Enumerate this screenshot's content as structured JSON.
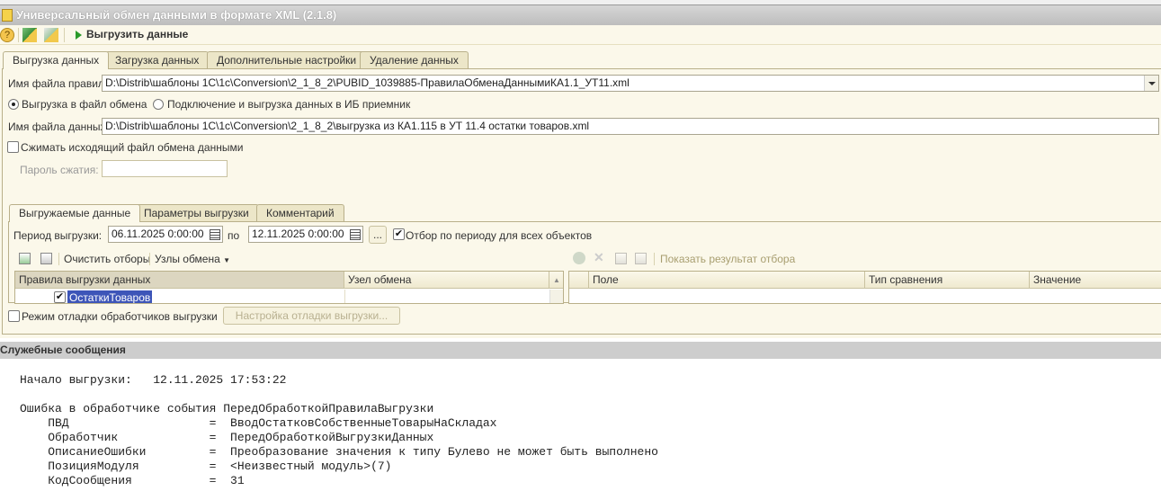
{
  "window": {
    "title": "Универсальный обмен данными в формате XML (2.1.8)"
  },
  "toolbar": {
    "run_label": "Выгрузить данные"
  },
  "tabs": [
    {
      "label": "Выгрузка данных"
    },
    {
      "label": "Загрузка данных"
    },
    {
      "label": "Дополнительные настройки"
    },
    {
      "label": "Удаление данных"
    }
  ],
  "form": {
    "rules_file_label": "Имя файла правил:",
    "rules_file_value": "D:\\Distrib\\шаблоны 1С\\1с\\Conversion\\2_1_8_2\\PUBID_1039885-ПравилаОбменаДаннымиКА1.1_УТ11.xml",
    "radio_file": "Выгрузка в файл обмена",
    "radio_ib": "Подключение и выгрузка данных в ИБ приемник",
    "data_file_label": "Имя файла данных:",
    "data_file_value": "D:\\Distrib\\шаблоны 1С\\1с\\Conversion\\2_1_8_2\\выгрузка из КА1.115 в УТ 11.4 остатки товаров.xml",
    "compress_label": "Сжимать исходящий файл обмена данными",
    "password_label": "Пароль сжатия:",
    "password_value": ""
  },
  "inner_tabs": [
    {
      "label": "Выгружаемые данные"
    },
    {
      "label": "Параметры выгрузки"
    },
    {
      "label": "Комментарий"
    }
  ],
  "period": {
    "label": "Период выгрузки:",
    "from": "06.11.2025  0:00:00",
    "to_label": "по",
    "to": "12.11.2025  0:00:00",
    "more": "...",
    "filter_all": "Отбор по периоду для всех объектов"
  },
  "rules_toolbar": {
    "clear": "Очистить отборы",
    "nodes": "Узлы обмена"
  },
  "filter_toolbar": {
    "show_result": "Показать результат отбора"
  },
  "rules_table": {
    "columns": [
      "Правила выгрузки данных",
      "Узел обмена"
    ],
    "rows": [
      {
        "name": "ОстаткиТоваров",
        "checked": true,
        "node": ""
      }
    ]
  },
  "filter_table": {
    "columns": [
      "Поле",
      "Тип сравнения",
      "Значение"
    ]
  },
  "debug": {
    "label": "Режим отладки обработчиков выгрузки",
    "button": "Настройка отладки выгрузки..."
  },
  "messages": {
    "title": "Служебные сообщения",
    "lines": [
      "Начало выгрузки:   12.11.2025 17:53:22",
      "Ошибка в обработчике события ПередОбработкойПравилаВыгрузки",
      "    ПВД                    =  ВводОстатковСобственныеТоварыНаСкладах",
      "    Обработчик             =  ПередОбработкойВыгрузкиДанных",
      "    ОписаниеОшибки         =  Преобразование значения к типу Булево не может быть выполнено",
      "    ПозицияМодуля          =  <Неизвестный модуль>(7)",
      "    КодСообщения           =  31"
    ]
  }
}
